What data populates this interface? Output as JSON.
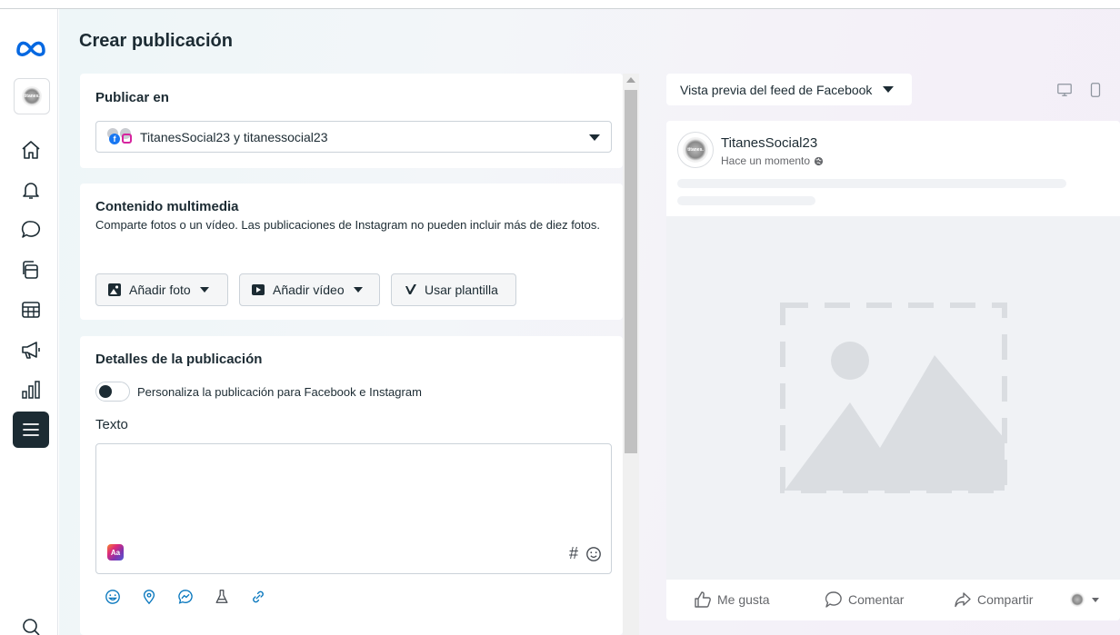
{
  "page": {
    "title": "Crear publicación"
  },
  "publish_in": {
    "title": "Publicar en",
    "accounts_label": "TitanesSocial23 y titanessocial23"
  },
  "media": {
    "title": "Contenido multimedia",
    "description": "Comparte fotos o un vídeo. Las publicaciones de Instagram no pueden incluir más de diez fotos.",
    "add_photo": "Añadir foto",
    "add_video": "Añadir vídeo",
    "use_template": "Usar plantilla"
  },
  "details": {
    "title": "Detalles de la publicación",
    "customize_label": "Personaliza la publicación para Facebook e Instagram",
    "text_label": "Texto",
    "hash_symbol": "#",
    "ai_badge": "Aa"
  },
  "preview": {
    "dropdown_label": "Vista previa del feed de Facebook",
    "page_name": "TitanesSocial23",
    "time": "Hace un momento",
    "like": "Me gusta",
    "comment": "Comentar",
    "share": "Compartir"
  },
  "avatar_text": "titanes."
}
